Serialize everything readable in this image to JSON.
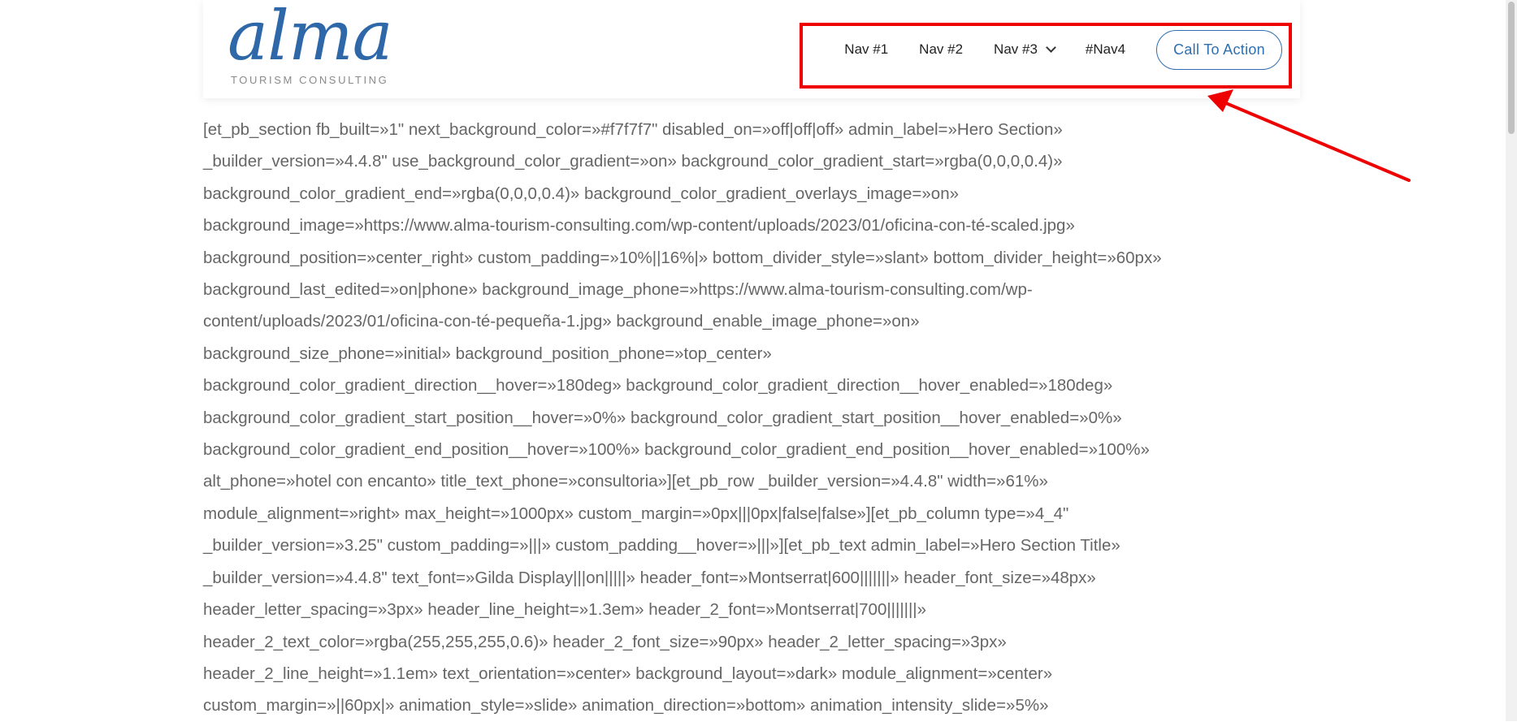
{
  "logo": {
    "wordmark": "alma",
    "tagline": "TOURISM CONSULTING"
  },
  "nav": {
    "items": [
      "Nav #1",
      "Nav #2",
      "Nav #3",
      "#Nav4"
    ],
    "dropdown_icon": "chevron-down-icon",
    "cta_label": "Call To Action"
  },
  "colors": {
    "brand": "#2e68a8",
    "cta": "#2f6fb0",
    "annotation": "#ee0000",
    "body_text": "#666666"
  },
  "content": {
    "lines": [
      "[et_pb_section fb_built=»1\" next_background_color=»#f7f7f7\" disabled_on=»off|off|off» admin_label=»Hero Section»",
      "_builder_version=»4.4.8\" use_background_color_gradient=»on» background_color_gradient_start=»rgba(0,0,0,0.4)»",
      "background_color_gradient_end=»rgba(0,0,0,0.4)» background_color_gradient_overlays_image=»on»",
      "background_image=»https://www.alma-tourism-consulting.com/wp-content/uploads/2023/01/oficina-con-té-scaled.jpg»",
      "background_position=»center_right» custom_padding=»10%||16%|» bottom_divider_style=»slant» bottom_divider_height=»60px»",
      "background_last_edited=»on|phone» background_image_phone=»https://www.alma-tourism-consulting.com/wp-",
      "content/uploads/2023/01/oficina-con-té-pequeña-1.jpg» background_enable_image_phone=»on»",
      "background_size_phone=»initial» background_position_phone=»top_center»",
      "background_color_gradient_direction__hover=»180deg» background_color_gradient_direction__hover_enabled=»180deg»",
      "background_color_gradient_start_position__hover=»0%» background_color_gradient_start_position__hover_enabled=»0%»",
      "background_color_gradient_end_position__hover=»100%» background_color_gradient_end_position__hover_enabled=»100%»",
      "alt_phone=»hotel con encanto» title_text_phone=»consultoria»][et_pb_row _builder_version=»4.4.8\" width=»61%»",
      "module_alignment=»right» max_height=»1000px» custom_margin=»0px|||0px|false|false»][et_pb_column type=»4_4\"",
      "_builder_version=»3.25\" custom_padding=»|||» custom_padding__hover=»|||»][et_pb_text admin_label=»Hero Section Title»",
      "_builder_version=»4.4.8\" text_font=»Gilda Display|||on|||||» header_font=»Montserrat|600|||||||» header_font_size=»48px»",
      "header_letter_spacing=»3px» header_line_height=»1.3em» header_2_font=»Montserrat|700|||||||»",
      "header_2_text_color=»rgba(255,255,255,0.6)» header_2_font_size=»90px» header_2_letter_spacing=»3px»",
      "header_2_line_height=»1.1em» text_orientation=»center» background_layout=»dark» module_alignment=»center»",
      "custom_margin=»||60px|» animation_style=»slide» animation_direction=»bottom» animation_intensity_slide=»5%»"
    ]
  }
}
